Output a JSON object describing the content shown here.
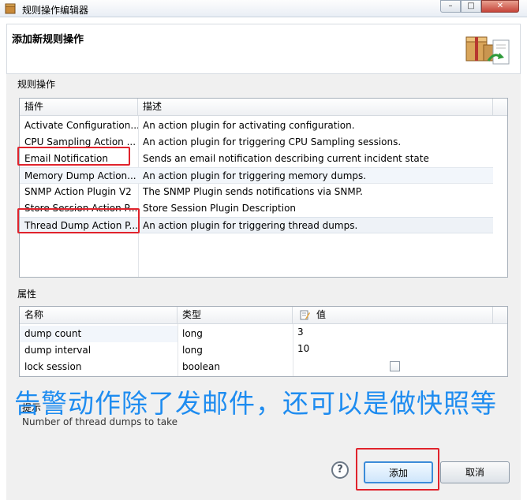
{
  "window": {
    "title": "规则操作编辑器",
    "min_glyph": "–",
    "max_glyph": "□",
    "close_glyph": "✕"
  },
  "banner": {
    "title": "添加新规则操作"
  },
  "rule_ops": {
    "group_label": "规则操作",
    "columns": [
      "插件",
      "描述"
    ],
    "rows": [
      {
        "plugin": "Activate Configuration...",
        "desc": "An action plugin for activating configuration."
      },
      {
        "plugin": "CPU Sampling Action ...",
        "desc": "An action plugin for triggering CPU Sampling sessions."
      },
      {
        "plugin": "Email Notification",
        "desc": "Sends an email notification describing current incident state"
      },
      {
        "plugin": "Memory Dump Action...",
        "desc": "An action plugin for triggering memory dumps."
      },
      {
        "plugin": "SNMP Action Plugin V2",
        "desc": "The SNMP Plugin sends notifications via SNMP."
      },
      {
        "plugin": "Store Session Action P...",
        "desc": "Store Session Plugin Description"
      },
      {
        "plugin": "Thread Dump Action P...",
        "desc": "An action plugin for triggering thread dumps."
      }
    ]
  },
  "properties": {
    "group_label": "属性",
    "columns": [
      "名称",
      "类型",
      "值"
    ],
    "rows": [
      {
        "name": "dump count",
        "type": "long",
        "value": "3"
      },
      {
        "name": "dump interval",
        "type": "long",
        "value": "10"
      },
      {
        "name": "lock session",
        "type": "boolean",
        "value": ""
      }
    ]
  },
  "hint": {
    "label": "提示",
    "text": "Number of thread dumps to take"
  },
  "overlay_caption": "告警动作除了发邮件，还可以是做快照等",
  "buttons": {
    "add": "添加",
    "cancel": "取消",
    "help": "?"
  },
  "colors": {
    "highlight": "#e0232c",
    "caption": "#1e8cf0"
  }
}
